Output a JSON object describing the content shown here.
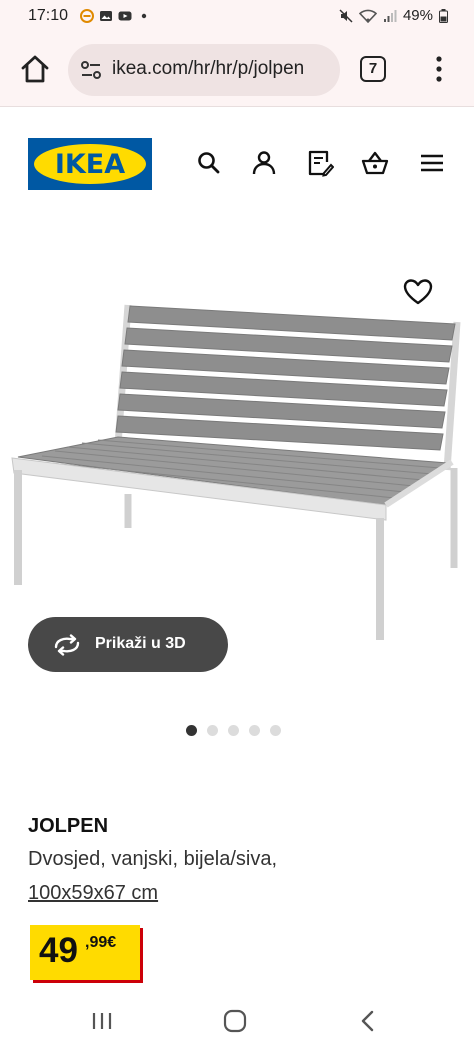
{
  "status_bar": {
    "time": "17:10",
    "battery": "49%"
  },
  "browser": {
    "url": "ikea.com/hr/hr/p/jolpen",
    "tab_count": "7"
  },
  "header": {
    "logo_text": "IKEA",
    "icons": [
      "search-icon",
      "user-icon",
      "shopping-list-icon",
      "basket-icon",
      "hamburger-menu-icon"
    ]
  },
  "gallery": {
    "view_3d_label": "Prikaži u 3D",
    "image_count": 5,
    "active_index": 0
  },
  "product": {
    "name": "JOLPEN",
    "description": "Dvosjed, vanjski, bijela/siva,",
    "dimensions": "100x59x67 cm",
    "price_integer": "49",
    "price_decimal": ",99€"
  },
  "colors": {
    "ikea_blue": "#0058a3",
    "ikea_yellow": "#ffdb00",
    "price_shadow_red": "#cc0008",
    "button_dark": "#484848"
  }
}
